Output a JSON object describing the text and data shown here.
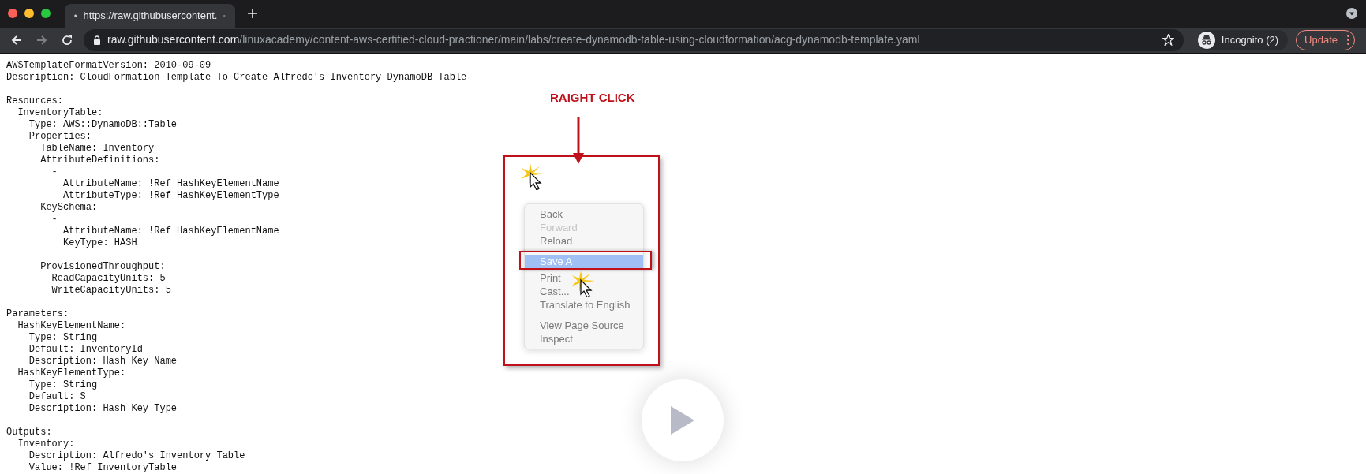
{
  "tab": {
    "title": "https://raw.githubusercontent.",
    "selected": true
  },
  "address_bar": {
    "host": "raw.githubusercontent.com",
    "path": "/linuxacademy/content-aws-certified-cloud-practioner/main/labs/create-dynamodb-table-using-cloudformation/acg-dynamodb-template.yaml"
  },
  "profile": {
    "label": "Incognito (2)"
  },
  "update_button": {
    "label": "Update"
  },
  "code_blocks": [
    [
      "AWSTemplateFormatVersion: 2010-09-09",
      "Description: CloudFormation Template To Create Alfredo's Inventory DynamoDB Table"
    ],
    [
      "Resources:",
      "  InventoryTable:",
      "    Type: AWS::DynamoDB::Table",
      "    Properties:",
      "      TableName: Inventory",
      "      AttributeDefinitions:",
      "        -",
      "          AttributeName: !Ref HashKeyElementName",
      "          AttributeType: !Ref HashKeyElementType",
      "      KeySchema:",
      "        -",
      "          AttributeName: !Ref HashKeyElementName",
      "          KeyType: HASH"
    ],
    [
      "      ProvisionedThroughput:",
      "        ReadCapacityUnits: 5",
      "        WriteCapacityUnits: 5"
    ],
    [
      "Parameters:",
      "  HashKeyElementName:",
      "    Type: String",
      "    Default: InventoryId",
      "    Description: Hash Key Name",
      "  HashKeyElementType:",
      "    Type: String",
      "    Default: S",
      "    Description: Hash Key Type"
    ],
    [
      "Outputs:",
      "  Inventory:",
      "    Description: Alfredo's Inventory Table",
      "    Value: !Ref InventoryTable"
    ]
  ],
  "annotation": {
    "label": "RAIGHT CLICK"
  },
  "context_menu": {
    "groups": [
      [
        {
          "label": "Back",
          "disabled": false,
          "selected": false
        },
        {
          "label": "Forward",
          "disabled": true,
          "selected": false
        },
        {
          "label": "Reload",
          "disabled": false,
          "selected": false
        }
      ],
      [
        {
          "label": "Save A",
          "disabled": false,
          "selected": true
        },
        {
          "label": "Print",
          "disabled": false,
          "selected": false
        },
        {
          "label": "Cast...",
          "disabled": false,
          "selected": false
        },
        {
          "label": "Translate to English",
          "disabled": false,
          "selected": false
        }
      ],
      [
        {
          "label": "View Page Source",
          "disabled": false,
          "selected": false
        },
        {
          "label": "Inspect",
          "disabled": false,
          "selected": false
        }
      ]
    ]
  }
}
